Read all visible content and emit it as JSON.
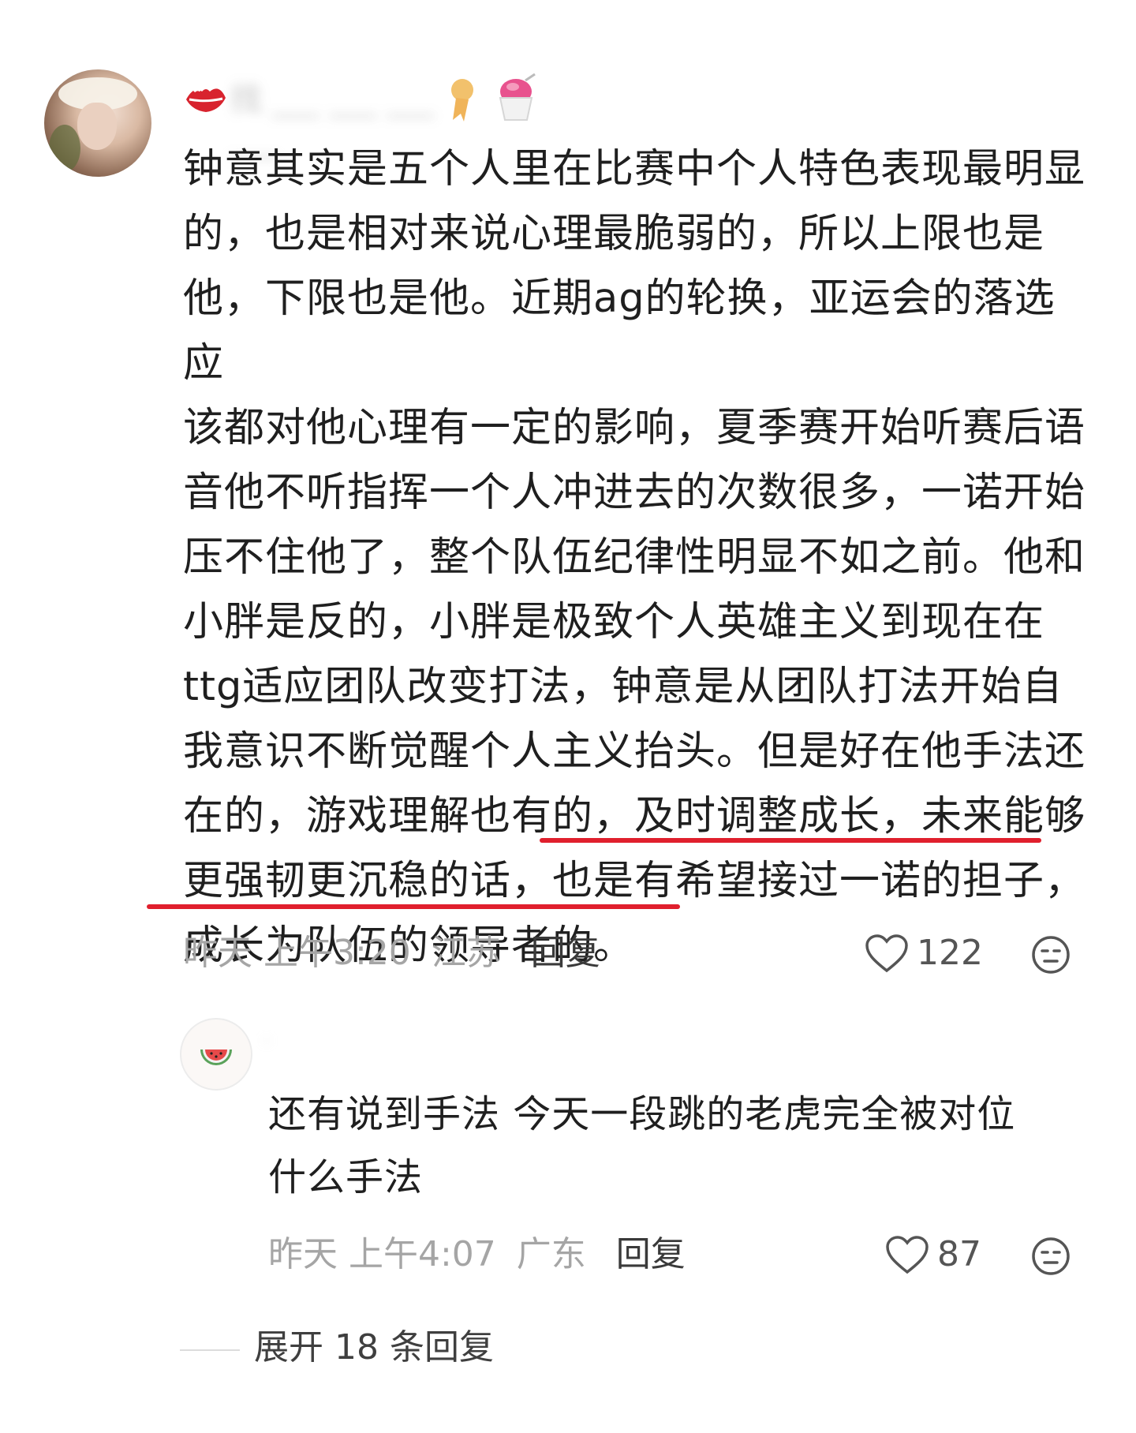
{
  "comment": {
    "username": "找 ___ ___ ___ ___",
    "lines": [
      "钟意其实是五个人里在比赛中个人特色表现最明显",
      "的，也是相对来说心理最脆弱的，所以上限也是",
      "他，下限也是他。近期ag的轮换，亚运会的落选应",
      "该都对他心理有一定的影响，夏季赛开始听赛后语",
      "音他不听指挥一个人冲进去的次数很多，一诺开始",
      "压不住他了，整个队伍纪律性明显不如之前。他和",
      "小胖是反的，小胖是极致个人英雄主义到现在在",
      "ttg适应团队改变打法，钟意是从团队打法开始自",
      "我意识不断觉醒个人主义抬头。但是好在他手法还",
      "在的，游戏理解也有的，及时调整成长，未来能够",
      "更强韧更沉稳的话，也是有希望接过一诺的担子，",
      "成长为队伍的领导者的。"
    ],
    "time": "昨天 上午3:20",
    "location": "江苏",
    "reply_label": "回复",
    "likes": "122",
    "highlight_color": "#e01f2d",
    "icons": {
      "badge_left": "lips-icon",
      "badge_right": "shaved-ice-icon",
      "like": "heart-outline-icon",
      "react": "neutral-face-icon"
    }
  },
  "reply": {
    "username": "·",
    "lines": [
      "还有说到手法 今天一段跳的老虎完全被对位",
      "什么手法"
    ],
    "time": "昨天 上午4:07",
    "location": "广东",
    "reply_label": "回复",
    "likes": "87",
    "icons": {
      "avatar": "watermelon-icon",
      "like": "heart-outline-icon",
      "react": "neutral-face-icon"
    }
  },
  "expand": {
    "label": "展开 18 条回复"
  }
}
